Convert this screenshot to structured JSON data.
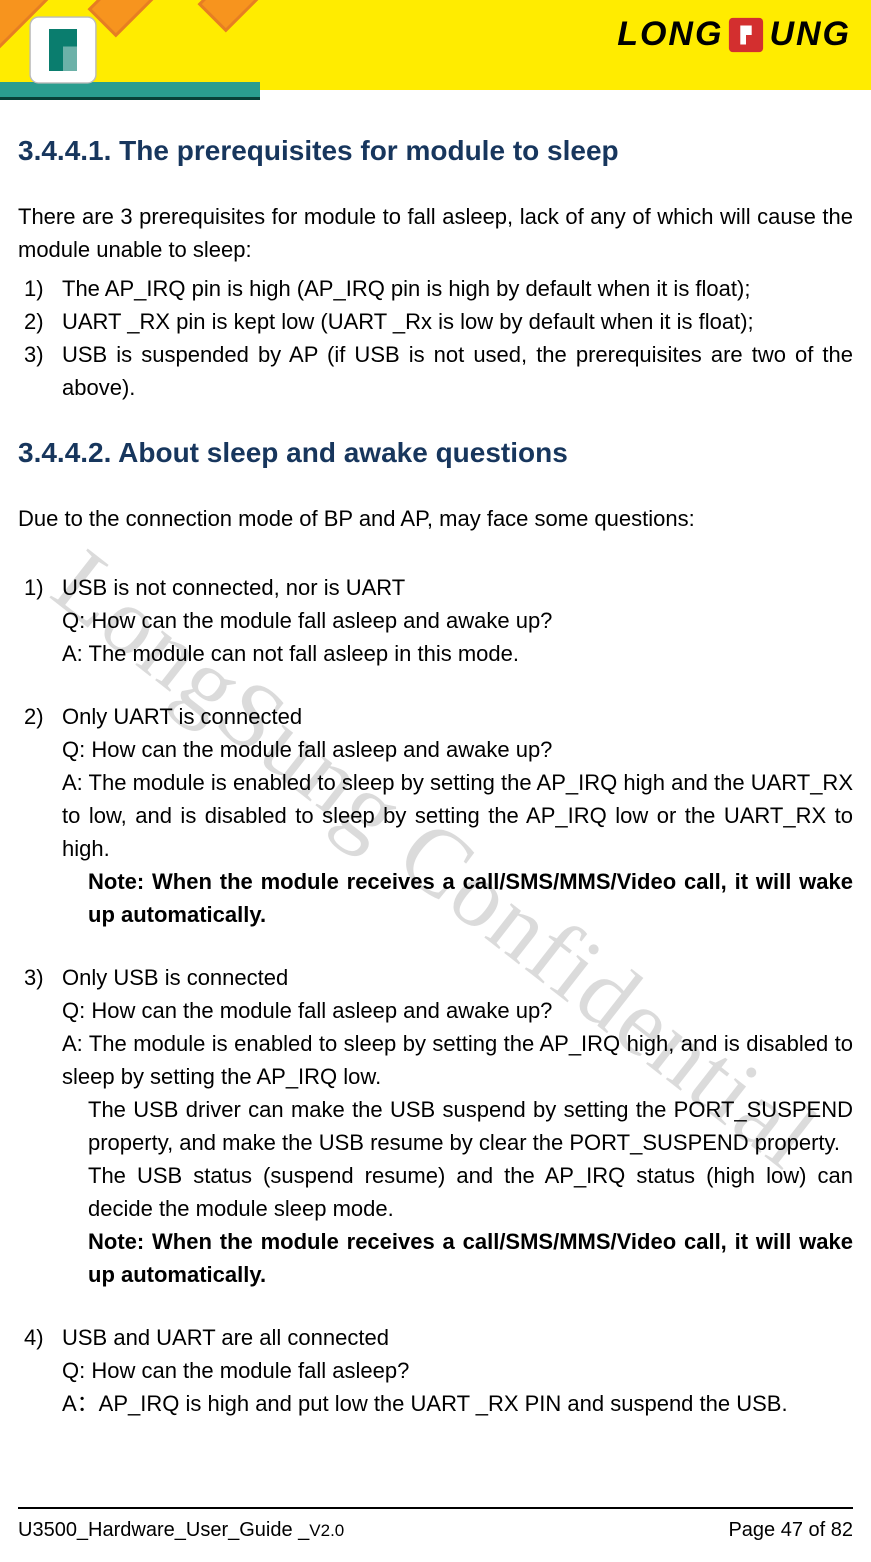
{
  "header": {
    "brand_left": "LONG",
    "brand_right": "UNG"
  },
  "watermark": "LongSung Confidential",
  "section1": {
    "heading": "3.4.4.1. The prerequisites for module to sleep",
    "intro": "There are 3 prerequisites for module to fall asleep, lack of any of which will cause the module unable to sleep:",
    "items": [
      {
        "num": "1)",
        "text": "The AP_IRQ pin is high (AP_IRQ pin is high by default when it is float);"
      },
      {
        "num": "2)",
        "text": "UART _RX pin is kept low (UART _Rx is low by default when it is float);"
      },
      {
        "num": "3)",
        "text": "USB is suspended by AP (if USB is not used, the prerequisites are two of the above)."
      }
    ]
  },
  "section2": {
    "heading": "3.4.4.2. About sleep and awake questions",
    "intro": "Due to the connection mode of BP and AP, may face some questions:",
    "items": [
      {
        "num": "1)",
        "title": "USB is not connected, nor is UART",
        "q": "Q: How can the module fall asleep and awake up?",
        "a": "A: The module can not fall asleep in this mode."
      },
      {
        "num": "2)",
        "title": "Only UART is connected",
        "q": "Q: How can the module fall asleep and awake up?",
        "a": "A: The module is enabled to sleep by setting the AP_IRQ high and the UART_RX to low, and is disabled to sleep by setting the AP_IRQ low or the UART_RX to high.",
        "note": "Note: When the module receives a call/SMS/MMS/Video call, it will wake up automatically."
      },
      {
        "num": "3)",
        "title": "Only USB is connected",
        "q": "Q: How can the module fall asleep and awake up?",
        "a": "A: The module is enabled to sleep by setting the AP_IRQ high, and is disabled to sleep by setting the AP_IRQ low.",
        "a2": "The USB driver can make the USB suspend by setting the PORT_SUSPEND property, and make the USB resume by clear the PORT_SUSPEND property.",
        "a3": "The USB status (suspend resume) and the AP_IRQ status (high low) can decide the module sleep mode.",
        "note": "Note: When the module receives a call/SMS/MMS/Video call, it will wake up automatically."
      },
      {
        "num": "4)",
        "title": "USB and UART are all connected",
        "q": "Q: How can the module fall asleep?",
        "a": "A：AP_IRQ is high and put low the UART _RX PIN and suspend the USB."
      }
    ]
  },
  "footer": {
    "left_doc": "U3500_Hardware_User_Guide _",
    "left_ver": "V2.0",
    "right": "Page 47 of 82"
  }
}
